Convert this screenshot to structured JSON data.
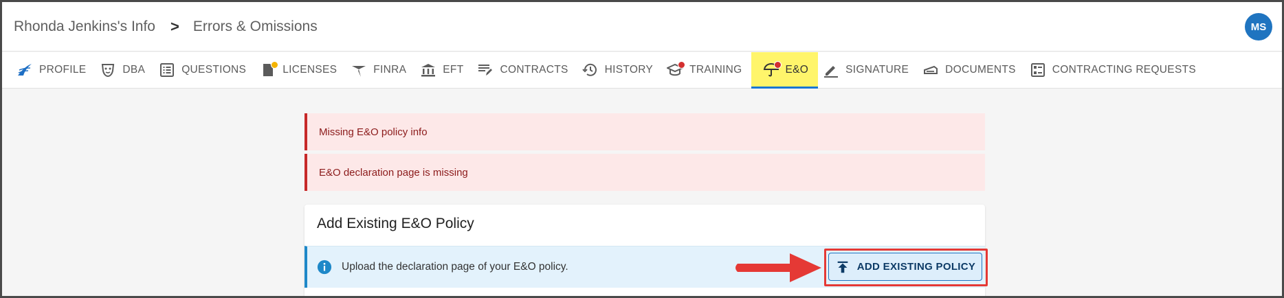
{
  "header": {
    "breadcrumb_parent": "Rhonda Jenkins's Info",
    "breadcrumb_separator": ">",
    "breadcrumb_current": "Errors & Omissions",
    "avatar_initials": "MS"
  },
  "tabs": [
    {
      "label": "PROFILE",
      "icon": "profile-logo-icon"
    },
    {
      "label": "DBA",
      "icon": "mask-icon"
    },
    {
      "label": "QUESTIONS",
      "icon": "list-icon"
    },
    {
      "label": "LICENSES",
      "icon": "license-icon",
      "badge_color": "#f5b400"
    },
    {
      "label": "FINRA",
      "icon": "finra-icon"
    },
    {
      "label": "EFT",
      "icon": "bank-icon"
    },
    {
      "label": "CONTRACTS",
      "icon": "contract-lines-icon"
    },
    {
      "label": "HISTORY",
      "icon": "history-icon"
    },
    {
      "label": "TRAINING",
      "icon": "graduation-cap-icon",
      "badge_color": "#d32f2f"
    },
    {
      "label": "E&O",
      "icon": "umbrella-icon",
      "badge_color": "#d32f2f",
      "active": true
    },
    {
      "label": "SIGNATURE",
      "icon": "pen-icon"
    },
    {
      "label": "DOCUMENTS",
      "icon": "documents-icon"
    },
    {
      "label": "CONTRACTING REQUESTS",
      "icon": "requests-icon"
    }
  ],
  "alerts": [
    {
      "text": "Missing E&O policy info"
    },
    {
      "text": "E&O declaration page is missing"
    }
  ],
  "card": {
    "title": "Add Existing E&O Policy",
    "info_text": "Upload the declaration page of your E&O policy.",
    "button_label": "ADD EXISTING POLICY"
  },
  "colors": {
    "accent": "#1f74c0",
    "active_tab_bg": "#fff56b",
    "alert_bg": "#fde8e8",
    "alert_border": "#c62828",
    "info_bg": "#e3f2fc",
    "highlight": "#e53935"
  }
}
